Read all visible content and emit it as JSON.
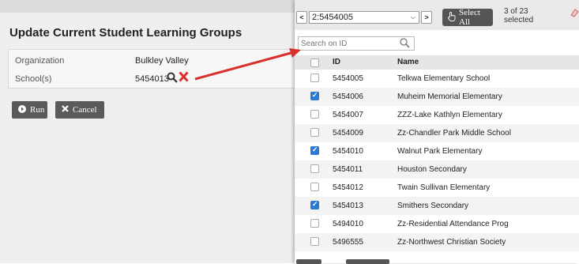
{
  "form": {
    "title": "Update Current Student Learning Groups",
    "fields": [
      {
        "label": "Organization",
        "value": "Bulkley Valley"
      },
      {
        "label": "School(s)",
        "value": "5454013"
      }
    ],
    "run_label": "Run",
    "cancel_label": "Cancel"
  },
  "picker": {
    "nav_prev": "<",
    "nav_next": ">",
    "selected_option": "2:5454005",
    "select_all_label": "Select All",
    "count_line1": "3 of 23",
    "count_line2": "selected",
    "search_placeholder": "Search on ID",
    "columns": {
      "id": "ID",
      "name": "Name"
    },
    "rows": [
      {
        "id": "5454005",
        "name": "Telkwa Elementary School",
        "checked": false
      },
      {
        "id": "5454006",
        "name": "Muheim Memorial Elementary",
        "checked": true
      },
      {
        "id": "5454007",
        "name": "ZZZ-Lake Kathlyn Elementary",
        "checked": false
      },
      {
        "id": "5454009",
        "name": "Zz-Chandler Park Middle School",
        "checked": false
      },
      {
        "id": "5454010",
        "name": "Walnut Park Elementary",
        "checked": true
      },
      {
        "id": "5454011",
        "name": "Houston Secondary",
        "checked": false
      },
      {
        "id": "5454012",
        "name": "Twain Sullivan Elementary",
        "checked": false
      },
      {
        "id": "5454013",
        "name": "Smithers Secondary",
        "checked": true
      },
      {
        "id": "5494010",
        "name": "Zz-Residential Attendance Prog",
        "checked": false
      },
      {
        "id": "5496555",
        "name": "Zz-Northwest Christian Society",
        "checked": false
      }
    ]
  },
  "colors": {
    "arrow": "#d9302c",
    "checked": "#2a7ad5",
    "delete": "#d9302c"
  },
  "icons": [
    "search-icon",
    "delete-x-icon",
    "run-arrow-icon",
    "cancel-x-icon",
    "hand-pointer-icon",
    "eraser-icon",
    "dropdown-chevron-icon",
    "search-button-icon"
  ]
}
